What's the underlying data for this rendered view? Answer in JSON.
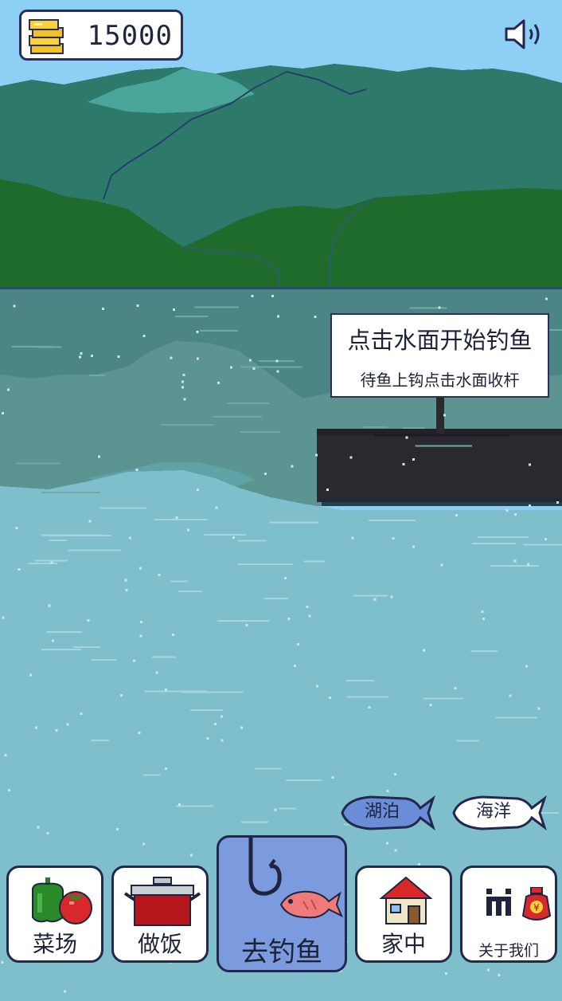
{
  "coins": {
    "value": "15000",
    "icon": "gold-coin-stack-icon"
  },
  "sound": {
    "icon": "speaker-icon"
  },
  "tooltip": {
    "title": "点击水面开始钓鱼",
    "subtitle": "待鱼上钩点击水面收杆"
  },
  "locations": [
    {
      "label": "湖泊",
      "selected": true,
      "color": "#6b8cd6"
    },
    {
      "label": "海洋",
      "selected": false,
      "color": "#ffffff"
    }
  ],
  "nav": {
    "farm_label": "菜场",
    "cook_label": "做饭",
    "fish_label": "去钓鱼",
    "home_label": "家中",
    "about_label": "关于我们"
  },
  "colors": {
    "sky": "#8ecff5",
    "water": "#7fbfcc",
    "accent": "#7b9bde",
    "outline": "#23284d"
  }
}
